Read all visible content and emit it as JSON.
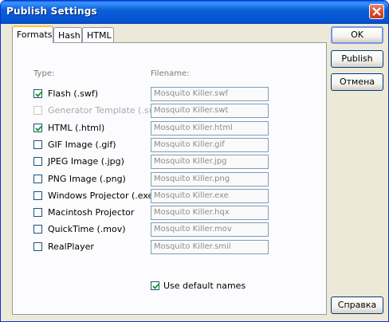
{
  "window": {
    "title": "Publish Settings"
  },
  "tabs": [
    {
      "label": "Formats"
    },
    {
      "label": "Hash"
    },
    {
      "label": "HTML"
    }
  ],
  "columns": {
    "type_header": "Type:",
    "filename_header": "Filename:"
  },
  "rows": [
    {
      "label": "Flash (.swf)",
      "filename": "Mosquito Killer.swf",
      "checked": true,
      "disabled": false
    },
    {
      "label": "Generator Template (.swt)",
      "filename": "Mosquito Killer.swt",
      "checked": false,
      "disabled": true
    },
    {
      "label": "HTML (.html)",
      "filename": "Mosquito Killer.html",
      "checked": true,
      "disabled": false
    },
    {
      "label": "GIF Image (.gif)",
      "filename": "Mosquito Killer.gif",
      "checked": false,
      "disabled": false
    },
    {
      "label": "JPEG Image (.jpg)",
      "filename": "Mosquito Killer.jpg",
      "checked": false,
      "disabled": false
    },
    {
      "label": "PNG Image (.png)",
      "filename": "Mosquito Killer.png",
      "checked": false,
      "disabled": false
    },
    {
      "label": "Windows Projector (.exe)",
      "filename": "Mosquito Killer.exe",
      "checked": false,
      "disabled": false
    },
    {
      "label": "Macintosh Projector",
      "filename": "Mosquito Killer.hqx",
      "checked": false,
      "disabled": false
    },
    {
      "label": "QuickTime (.mov)",
      "filename": "Mosquito Killer.mov",
      "checked": false,
      "disabled": false
    },
    {
      "label": "RealPlayer",
      "filename": "Mosquito Killer.smil",
      "checked": false,
      "disabled": false
    }
  ],
  "use_default_names": {
    "label": "Use default names",
    "checked": true
  },
  "buttons": {
    "ok": "OK",
    "publish": "Publish",
    "cancel": "Отмена",
    "help": "Справка"
  }
}
